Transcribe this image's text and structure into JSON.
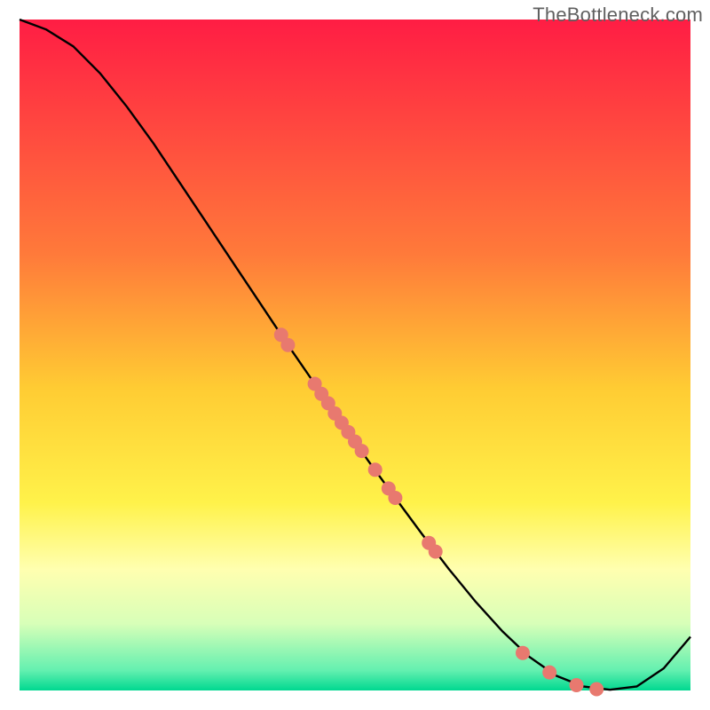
{
  "watermark": "TheBottleneck.com",
  "chart_data": {
    "type": "line",
    "title": "",
    "xlabel": "",
    "ylabel": "",
    "xlim": [
      0,
      100
    ],
    "ylim": [
      0,
      100
    ],
    "axes_visible": false,
    "gradient_stops": [
      {
        "offset": 0,
        "color": "#ff1d44"
      },
      {
        "offset": 35,
        "color": "#ff7a3a"
      },
      {
        "offset": 55,
        "color": "#ffcc33"
      },
      {
        "offset": 72,
        "color": "#fff24a"
      },
      {
        "offset": 82,
        "color": "#ffffb0"
      },
      {
        "offset": 90,
        "color": "#d8ffb8"
      },
      {
        "offset": 97,
        "color": "#64f0b0"
      },
      {
        "offset": 100,
        "color": "#00d890"
      }
    ],
    "series": [
      {
        "name": "curve",
        "color": "#000000",
        "stroke_width": 2.4,
        "x": [
          0,
          4,
          8,
          12,
          16,
          20,
          24,
          28,
          32,
          36,
          40,
          44,
          48,
          52,
          56,
          60,
          64,
          68,
          72,
          76,
          80,
          84,
          88,
          92,
          96,
          100
        ],
        "y": [
          100,
          98.5,
          96,
          92,
          87,
          81.5,
          75.5,
          69.5,
          63.5,
          57.5,
          51.5,
          45.7,
          39.9,
          34.2,
          28.7,
          23.3,
          18.1,
          13.2,
          8.8,
          5.0,
          2.2,
          0.6,
          0.1,
          0.6,
          3.3,
          8.0
        ]
      }
    ],
    "scatter": {
      "name": "markers",
      "color": "#e8796f",
      "radius": 8,
      "x": [
        39,
        40,
        44,
        45,
        46,
        47,
        48,
        49,
        50,
        51,
        53,
        55,
        56,
        61,
        62,
        75,
        79,
        83,
        86
      ],
      "y": [
        53.0,
        51.5,
        45.7,
        44.2,
        42.8,
        41.3,
        39.9,
        38.5,
        37.1,
        35.7,
        32.9,
        30.1,
        28.7,
        22.0,
        20.7,
        5.6,
        2.7,
        0.8,
        0.2
      ]
    }
  }
}
